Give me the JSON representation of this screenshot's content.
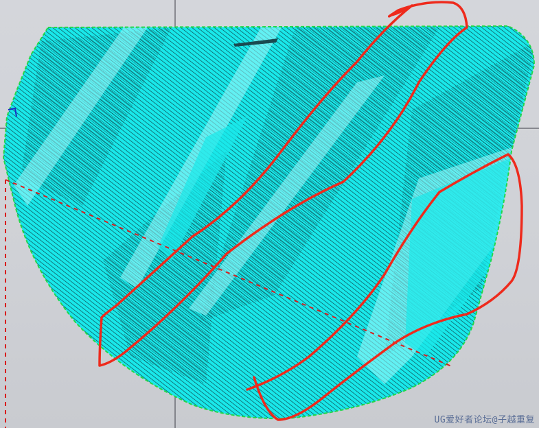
{
  "viewport": {
    "background_color": "#d0d2d7",
    "crosshair_color": "#3c3c46"
  },
  "part": {
    "fill_color": "#19e8ea",
    "hatch_color": "#0d2f35",
    "highlight_color": "#9ef7fa",
    "boundary_color": "#22d84a"
  },
  "toolpath_axis": {
    "color": "#d81e1e",
    "style": "dashed"
  },
  "annotations": {
    "color": "#ee2a1c",
    "count": 2
  },
  "watermark": {
    "text": "UG爱好者论坛@子越重复"
  }
}
